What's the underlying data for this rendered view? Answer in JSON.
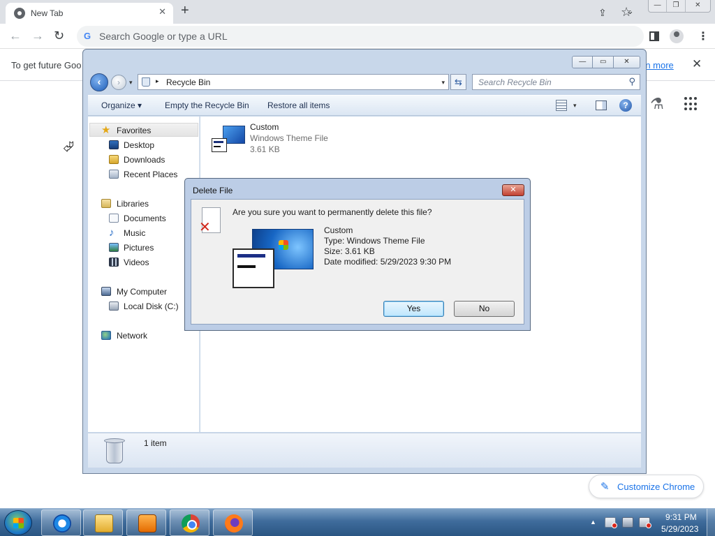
{
  "browser": {
    "tab_title": "New Tab",
    "tab_close": "✕",
    "new_tab": "+",
    "tab_search": "⌄",
    "window_buttons": {
      "minimize": "—",
      "restore": "❐",
      "close": "✕"
    },
    "omnibox_placeholder": "Search Google or type a URL",
    "google_g": "G",
    "info_bar_text": "To get future Goo",
    "info_bar_link": "rn more",
    "info_bar_close": "✕",
    "customize_label": "Customize Chrome",
    "icons": {
      "back": "←",
      "forward": "→",
      "reload": "↻",
      "share": "⇪",
      "star": "☆",
      "menu": "⋮",
      "labs": "⚗",
      "pen": "✎",
      "cursor": "⮰"
    }
  },
  "explorer": {
    "window_buttons": {
      "minimize": "—",
      "maximize": "▭",
      "close": "✕"
    },
    "address_path": "Recycle Bin",
    "search_placeholder": "Search Recycle Bin",
    "commands": {
      "organize": "Organize ▾",
      "empty": "Empty the Recycle Bin",
      "restore": "Restore all items"
    },
    "nav": {
      "favorites": "Favorites",
      "desktop": "Desktop",
      "downloads": "Downloads",
      "recent_places": "Recent Places",
      "libraries": "Libraries",
      "documents": "Documents",
      "music": "Music",
      "pictures": "Pictures",
      "videos": "Videos",
      "my_computer": "My Computer",
      "local_disk": "Local Disk (C:)",
      "network": "Network"
    },
    "file": {
      "name": "Custom",
      "type": "Windows Theme File",
      "size": "3.61 KB"
    },
    "details_count": "1 item"
  },
  "dialog": {
    "title": "Delete File",
    "close": "✕",
    "question": "Are you sure you want to permanently delete this file?",
    "file_name": "Custom",
    "file_type": "Type: Windows Theme File",
    "file_size": "Size: 3.61 KB",
    "date_modified": "Date modified: 5/29/2023 9:30 PM",
    "yes_label": "Yes",
    "no_label": "No"
  },
  "taskbar": {
    "apps": [
      "internet-explorer",
      "windows-explorer",
      "media-player",
      "google-chrome",
      "firefox"
    ],
    "time": "9:31 PM",
    "date": "5/29/2023",
    "tray_arrow": "▲"
  },
  "colors": {
    "chrome_tabstrip": "#dee1e6",
    "chrome_link": "#1a73e8",
    "aero_frame": "#c8d7ea",
    "dialog_frame": "#bccde6",
    "taskbar": "#3f6c9c",
    "close_red": "#c24132"
  }
}
